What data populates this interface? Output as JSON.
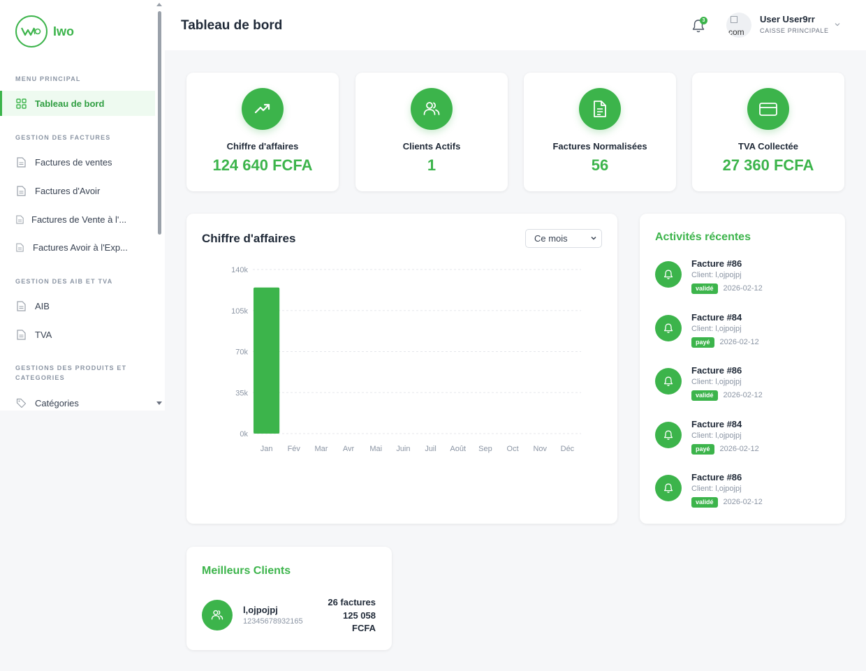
{
  "brand": {
    "name": "Iwo",
    "accent": "#3cb44b"
  },
  "sidebar": {
    "sections": [
      {
        "title": "MENU PRINCIPAL"
      },
      {
        "title": "GESTION DES FACTURES"
      },
      {
        "title": "GESTION DES AIB ET TVA"
      },
      {
        "title": "GESTIONS DES PRODUITS ET CATEGORIES"
      }
    ],
    "items": [
      {
        "label": "Tableau de bord",
        "icon": "dashboard-grid-icon",
        "active": true
      },
      {
        "label": "Factures de ventes",
        "icon": "document-icon"
      },
      {
        "label": "Factures d'Avoir",
        "icon": "document-icon"
      },
      {
        "label": "Factures de Vente à l'...",
        "icon": "document-icon"
      },
      {
        "label": "Factures Avoir à l'Exp...",
        "icon": "document-icon"
      },
      {
        "label": "AIB",
        "icon": "document-icon"
      },
      {
        "label": "TVA",
        "icon": "document-icon"
      },
      {
        "label": "Catégories",
        "icon": "tag-icon"
      }
    ]
  },
  "header": {
    "title": "Tableau de bord",
    "notifications": "3",
    "avatar_alt": "com",
    "user_name": "User User9rr",
    "user_role": "CAISSE PRINCIPALE"
  },
  "stats": [
    {
      "label": "Chiffre d'affaires",
      "value": "124 640 FCFA",
      "icon": "trending-up-icon"
    },
    {
      "label": "Clients Actifs",
      "value": "1",
      "icon": "users-icon"
    },
    {
      "label": "Factures Normalisées",
      "value": "56",
      "icon": "file-text-icon"
    },
    {
      "label": "TVA Collectée",
      "value": "27 360 FCFA",
      "icon": "credit-card-icon"
    }
  ],
  "revenue_chart": {
    "title": "Chiffre d'affaires",
    "period_select": "Ce mois"
  },
  "chart_data": {
    "type": "bar",
    "title": "Chiffre d'affaires",
    "categories": [
      "Jan",
      "Fév",
      "Mar",
      "Avr",
      "Mai",
      "Juin",
      "Juil",
      "Août",
      "Sep",
      "Oct",
      "Nov",
      "Déc"
    ],
    "values": [
      124640,
      0,
      0,
      0,
      0,
      0,
      0,
      0,
      0,
      0,
      0,
      0
    ],
    "ylim": [
      0,
      140000
    ],
    "yticks": [
      "0k",
      "35k",
      "70k",
      "105k",
      "140k"
    ],
    "grid": true,
    "color": "#3cb44b"
  },
  "activities": {
    "title": "Activités récentes",
    "items": [
      {
        "title": "Facture #86",
        "client": "Client: l,ojpojpj",
        "status": "validé",
        "date": "2026-02-12"
      },
      {
        "title": "Facture #84",
        "client": "Client: l,ojpojpj",
        "status": "payé",
        "date": "2026-02-12"
      },
      {
        "title": "Facture #86",
        "client": "Client: l,ojpojpj",
        "status": "validé",
        "date": "2026-02-12"
      },
      {
        "title": "Facture #84",
        "client": "Client: l,ojpojpj",
        "status": "payé",
        "date": "2026-02-12"
      },
      {
        "title": "Facture #86",
        "client": "Client: l,ojpojpj",
        "status": "validé",
        "date": "2026-02-12"
      }
    ]
  },
  "best_clients": {
    "title": "Meilleurs Clients",
    "items": [
      {
        "name": "l,ojpojpj",
        "id": "12345678932165",
        "invoices": "26 factures",
        "amount": "125 058 FCFA"
      }
    ]
  }
}
